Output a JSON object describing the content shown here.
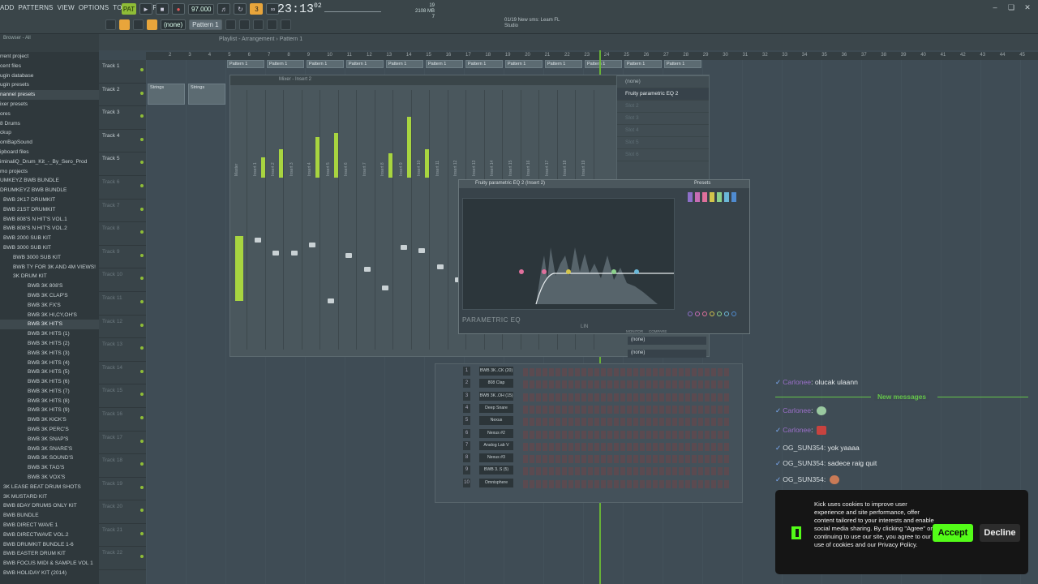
{
  "menu": [
    "ADD",
    "PATTERNS",
    "VIEW",
    "OPTIONS",
    "TOOLS",
    "HELP"
  ],
  "transport": {
    "pat_label": "PAT",
    "tempo": "97.000",
    "time": "23:13",
    "time_sub": "02",
    "pattern": "Pattern 1",
    "snap": "(none)",
    "cpu": "2108 MB",
    "cpu_num": "19",
    "cpu_sub": "7",
    "hint_line1": "01/19  New sms: Leam FL",
    "hint_line2": "Studio"
  },
  "browser": {
    "header": "Browser - All",
    "items": [
      "rrent project",
      "cent files",
      "ugin database",
      "ugin presets",
      "nannel presets",
      "ixer presets",
      "ores",
      "8 Drums",
      "ckup",
      "omBapSound",
      "ipboard files",
      "iminaliQ_Drum_Kit_-_By_Sero_Prod",
      "mo projects",
      "UMKEYZ BWB BUNDLE",
      "DRUMKEYZ BWB BUNDLE",
      "BWB 2K17 DRUMKIT",
      "BWB 21ST DRUMKIT",
      "BWB 808'S N HIT'S VOL.1",
      "BWB 808'S N HIT'S VOL.2",
      "BWB 2000 SUB KIT",
      "BWB 3000 SUB KIT",
      "BWB 3000 SUB KIT",
      "BWB TY FOR 3K AND 4M VIEWS!",
      "3K DRUM KIT",
      "BWB 3K 808'S",
      "BWB 3K CLAP'S",
      "BWB 3K FX'S",
      "BWB 3K HI,CY,OH'S",
      "BWB 3K HIT'S",
      "BWB 3K HITS (1)",
      "BWB 3K HITS (2)",
      "BWB 3K HITS (3)",
      "BWB 3K HITS (4)",
      "BWB 3K HITS (5)",
      "BWB 3K HITS (6)",
      "BWB 3K HITS (7)",
      "BWB 3K HITS (8)",
      "BWB 3K HITS (9)",
      "BWB 3K KICK'S",
      "BWB 3K PERC'S",
      "BWB 3K SNAP'S",
      "BWB 3K SNARE'S",
      "BWB 3K SOUND'S",
      "BWB 3K TAG'S",
      "BWB 3K VOX'S",
      "3K LEASE BEAT DRUM SHOTS",
      "3K MUSTARD KIT",
      "BWB 8DAY DRUMS ONLY KIT",
      "BWB BUNDLE",
      "BWB DIRECT WAVE 1",
      "BWB DIRECTWAVE VOL.2",
      "BWB DRUMKIT BUNDLE 1-6",
      "BWB EASTER DRUM KIT",
      "BWB FOCUS MIDI & SAMPLE VOL 1",
      "BWB HOLIDAY KIT (2014)"
    ]
  },
  "playlist": {
    "title": "Playlist - Arrangement › Pattern 1",
    "tracks": [
      "Track 1",
      "Track 2",
      "Track 3",
      "Track 4",
      "Track 5",
      "Track 6",
      "Track 7",
      "Track 8",
      "Track 9",
      "Track 10",
      "Track 11",
      "Track 12",
      "Track 13",
      "Track 14",
      "Track 15",
      "Track 16",
      "Track 17",
      "Track 18",
      "Track 19",
      "Track 20",
      "Track 21",
      "Track 22"
    ],
    "ruler": [
      "2",
      "3",
      "4",
      "5",
      "6",
      "7",
      "8",
      "9",
      "10",
      "11",
      "12",
      "13",
      "14",
      "15",
      "16",
      "17",
      "18",
      "19",
      "20",
      "21",
      "22",
      "23",
      "24",
      "25",
      "26",
      "27",
      "28",
      "29",
      "30",
      "31",
      "32",
      "33",
      "34",
      "35",
      "36",
      "37",
      "38",
      "39",
      "40",
      "41",
      "42",
      "43",
      "44",
      "45"
    ],
    "pattern_clip": "Pattern 1",
    "strings_clip": "Strings"
  },
  "mixer": {
    "title": "Mixer - Insert 2",
    "inserts": [
      "Master",
      "Insert 1",
      "Insert 2",
      "Insert 3",
      "Insert 4",
      "Insert 5",
      "Insert 6",
      "Insert 7",
      "Insert 8",
      "Insert 9",
      "Insert 10",
      "Insert 11",
      "Insert 12",
      "Insert 13",
      "Insert 14",
      "Insert 15",
      "Insert 16",
      "Insert 17",
      "Insert 18",
      "Insert 19"
    ]
  },
  "insert_panel": {
    "title": "Mixer - Insert 2",
    "slot_none": "(none)",
    "slots": [
      "Fruity parametric EQ 2",
      "Slot 2",
      "Slot 3",
      "Slot 4",
      "Slot 5",
      "Slot 6"
    ],
    "bottom_none_1": "(none)",
    "bottom_none_2": "(none)"
  },
  "eq": {
    "title": "Fruity parametric EQ 2 (Insert 2)",
    "presets": "Presets",
    "brand": "PARAMETRIC EQ",
    "mode": "LIN",
    "monitor": "MONITOR",
    "compare": "COMPARE"
  },
  "channelrack": {
    "channels": [
      {
        "num": "1",
        "name": "BWB 3K..CK (20)"
      },
      {
        "num": "2",
        "name": "808 Clap"
      },
      {
        "num": "3",
        "name": "BWB 3K..OH (15)"
      },
      {
        "num": "4",
        "name": "Deep Snare"
      },
      {
        "num": "5",
        "name": "Nexus"
      },
      {
        "num": "6",
        "name": "Nexus #2"
      },
      {
        "num": "7",
        "name": "Analog Lab V"
      },
      {
        "num": "8",
        "name": "Nexus #3"
      },
      {
        "num": "9",
        "name": "BWB 3..S (5)"
      },
      {
        "num": "10",
        "name": "Omnisphere"
      }
    ]
  },
  "chat": {
    "msg1_user": "Carlonee",
    "msg1_text": "olucak ulaann",
    "new_messages": "New messages",
    "msg2_user": "Carlonee",
    "msg3_user": "Carlonee",
    "msg4_user": "OG_SUN354",
    "msg4_text": "yok yaaaa",
    "msg5_user": "OG_SUN354",
    "msg5_text": "sadece raig quit",
    "msg6_user": "OG_SUN354"
  },
  "cookie": {
    "text": "Kick uses cookies to improve user experience and site performance, offer content tailored to your interests and enable social media sharing. By clicking \"Agree\" or continuing to use our site, you agree to our use of cookies and our Privacy Policy.",
    "accept": "Accept",
    "decline": "Decline",
    "accent": "#53fc18"
  },
  "colors": {
    "fl_green": "#8fbd37",
    "playhead": "#6ec233",
    "tool_orange": "#e8a53b"
  }
}
